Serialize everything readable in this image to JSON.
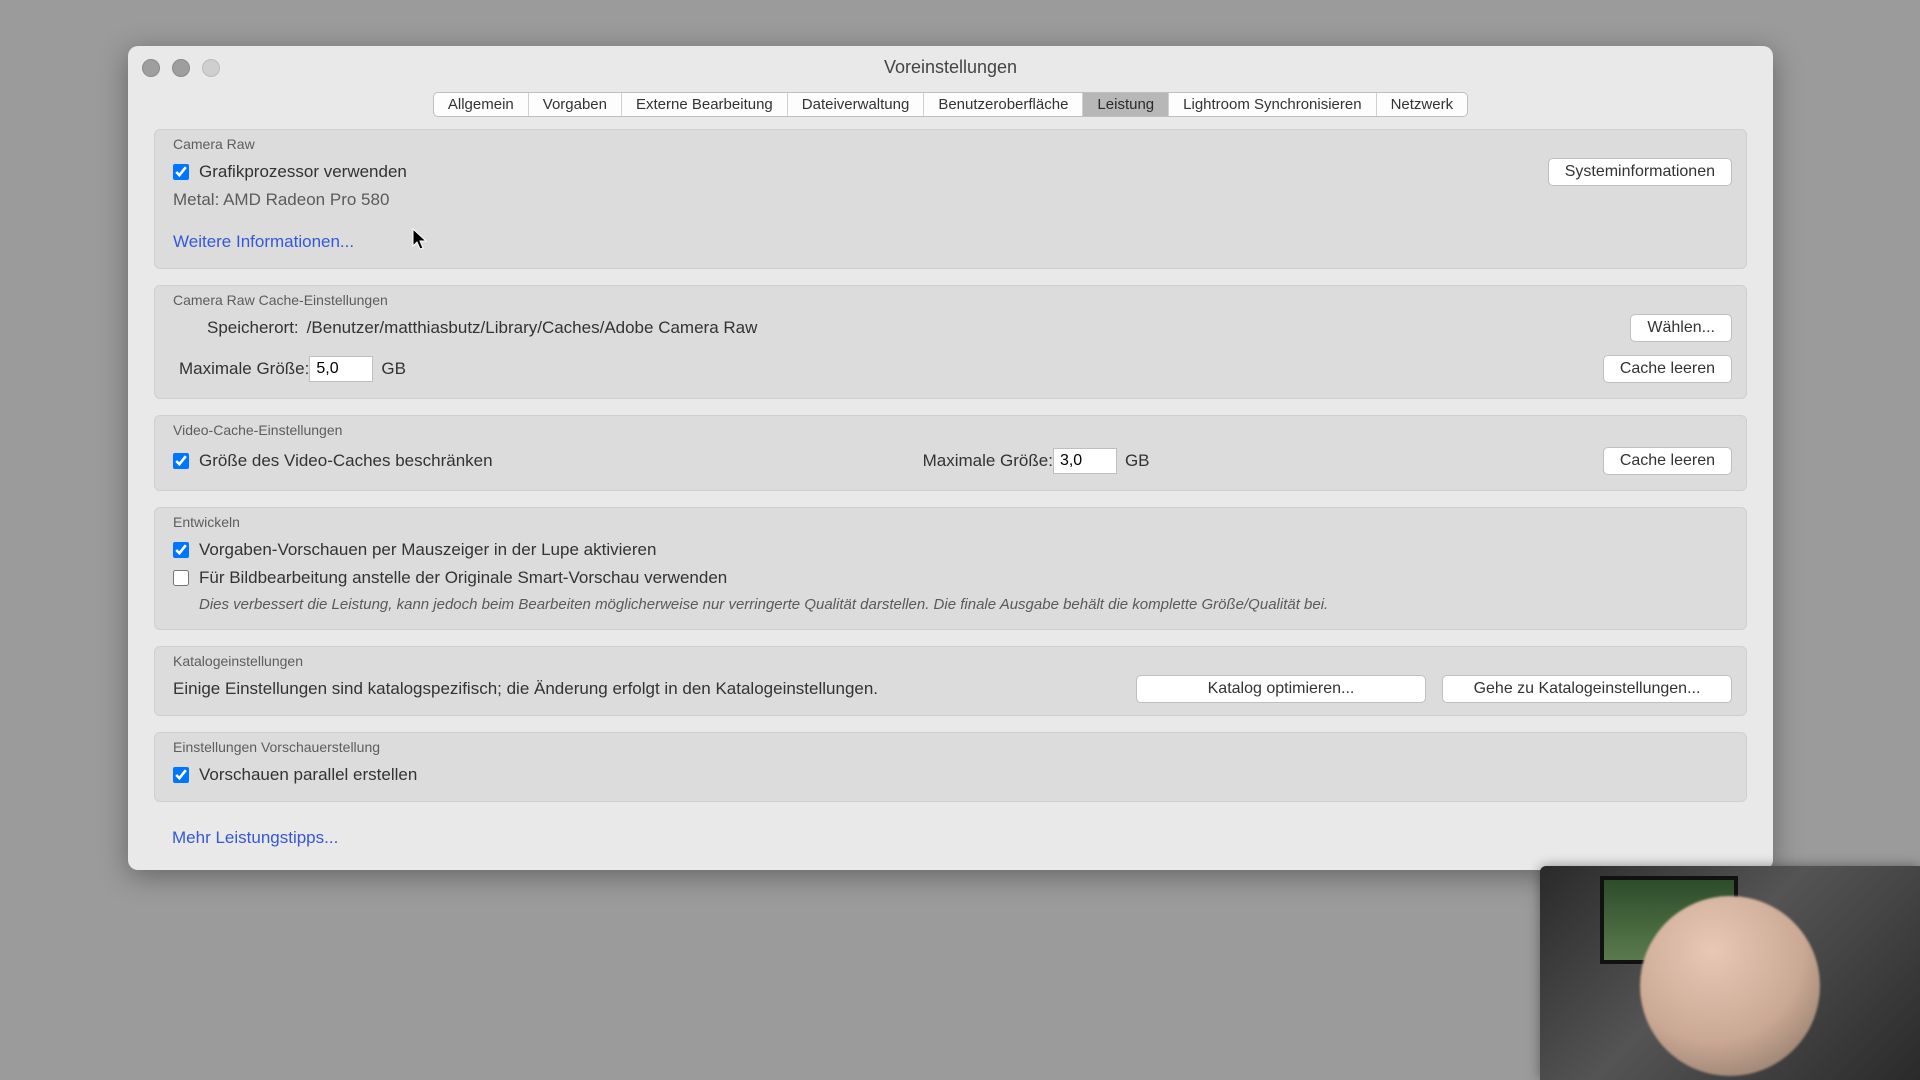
{
  "window": {
    "title": "Voreinstellungen"
  },
  "tabs": {
    "items": [
      "Allgemein",
      "Vorgaben",
      "Externe Bearbeitung",
      "Dateiverwaltung",
      "Benutzeroberfläche",
      "Leistung",
      "Lightroom Synchronisieren",
      "Netzwerk"
    ],
    "active_index": 5
  },
  "camera_raw": {
    "title": "Camera Raw",
    "use_gpu_label": "Grafikprozessor verwenden",
    "sysinfo_btn": "Systeminformationen",
    "metal_line": "Metal: AMD Radeon Pro 580",
    "more_info": "Weitere Informationen..."
  },
  "cr_cache": {
    "title": "Camera Raw Cache-Einstellungen",
    "location_label": "Speicherort:",
    "location_value": "/Benutzer/matthiasbutz/Library/Caches/Adobe Camera Raw",
    "choose_btn": "Wählen...",
    "maxsize_label": "Maximale Größe:",
    "maxsize_value": "5,0",
    "gb": "GB",
    "purge_btn": "Cache leeren"
  },
  "video_cache": {
    "title": "Video-Cache-Einstellungen",
    "limit_label": "Größe des Video-Caches beschränken",
    "maxsize_label": "Maximale Größe:",
    "maxsize_value": "3,0",
    "gb": "GB",
    "purge_btn": "Cache leeren"
  },
  "develop": {
    "title": "Entwickeln",
    "preset_hover_label": "Vorgaben-Vorschauen per Mauszeiger in der Lupe aktivieren",
    "smart_preview_label": "Für Bildbearbeitung anstelle der Originale Smart-Vorschau verwenden",
    "hint": "Dies verbessert die Leistung, kann jedoch beim Bearbeiten möglicherweise nur verringerte Qualität darstellen. Die finale Ausgabe behält die komplette Größe/Qualität bei."
  },
  "catalog": {
    "title": "Katalogeinstellungen",
    "text": "Einige Einstellungen sind katalogspezifisch; die Änderung erfolgt in den Katalogeinstellungen.",
    "optimize_btn": "Katalog optimieren...",
    "goto_btn": "Gehe zu Katalogeinstellungen..."
  },
  "previews": {
    "title": "Einstellungen Vorschauerstellung",
    "parallel_label": "Vorschauen parallel erstellen"
  },
  "more_tips": "Mehr Leistungstipps..."
}
